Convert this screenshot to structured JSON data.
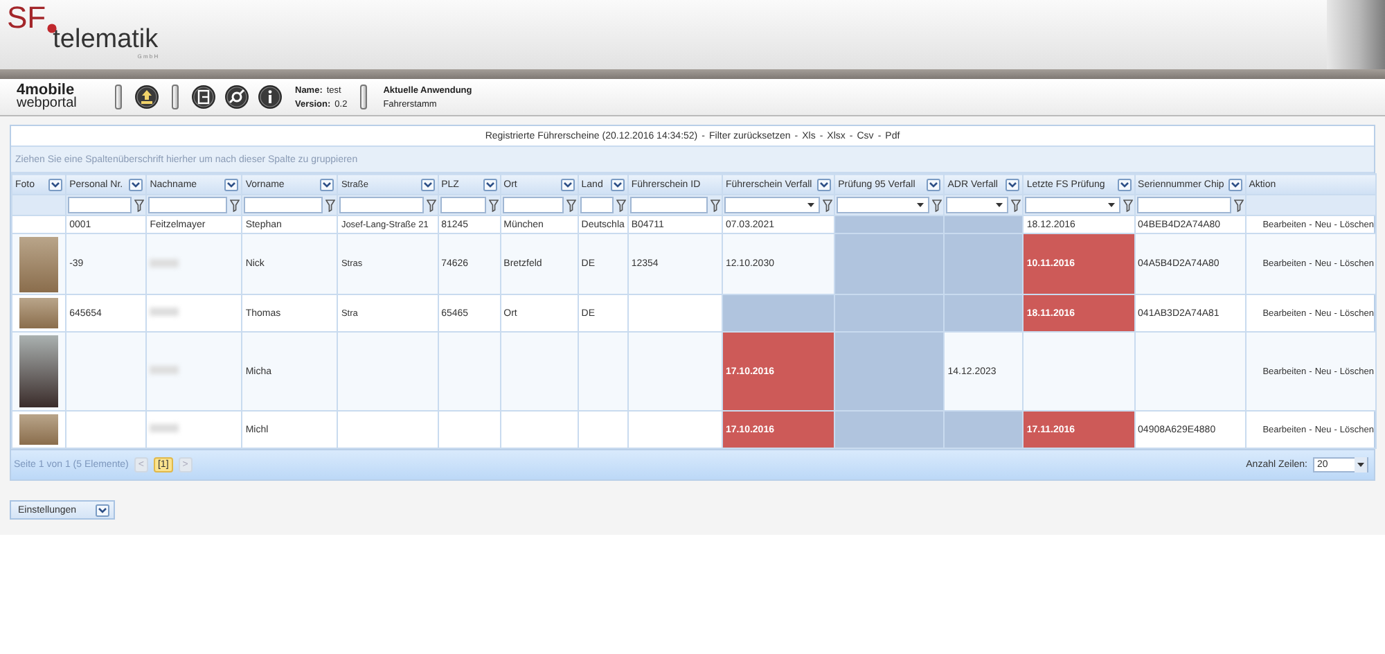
{
  "header": {
    "logo": {
      "prefix": "SF",
      "brand": "telematik",
      "suffix": "G m b H"
    },
    "portal": {
      "line1": "4mobile",
      "line2": "webportal"
    },
    "user_info": {
      "name_label": "Name:",
      "name": "test",
      "version_label": "Version:",
      "version": "0.2"
    },
    "application": {
      "label": "Aktuelle Anwendung",
      "value": "Fahrerstamm"
    }
  },
  "grid": {
    "title": "Registrierte Führerscheine (20.12.2016 14:34:52)",
    "separator": "-",
    "title_links": [
      "Filter zurücksetzen",
      "Xls",
      "Xlsx",
      "Csv",
      "Pdf"
    ],
    "group_hint": "Ziehen Sie eine Spaltenüberschrift hierher um nach dieser Spalte zu gruppieren",
    "columns": [
      {
        "label": "Foto",
        "menu": true,
        "filterable": false
      },
      {
        "label": "Personal Nr.",
        "menu": true,
        "filterable": true,
        "filter_dropdown": false
      },
      {
        "label": "Nachname",
        "menu": true,
        "filterable": true,
        "filter_dropdown": false
      },
      {
        "label": "Vorname",
        "menu": true,
        "filterable": true,
        "filter_dropdown": false
      },
      {
        "label": "Straße",
        "menu": true,
        "filterable": true,
        "filter_dropdown": false
      },
      {
        "label": "PLZ",
        "menu": true,
        "filterable": true,
        "filter_dropdown": false
      },
      {
        "label": "Ort",
        "menu": true,
        "filterable": true,
        "filter_dropdown": false
      },
      {
        "label": "Land",
        "menu": true,
        "filterable": true,
        "filter_dropdown": false
      },
      {
        "label": "Führerschein ID",
        "menu": false,
        "filterable": true,
        "filter_dropdown": false
      },
      {
        "label": "Führerschein Verfall",
        "menu": true,
        "filterable": true,
        "filter_dropdown": true
      },
      {
        "label": "Prüfung 95 Verfall",
        "menu": true,
        "filterable": true,
        "filter_dropdown": true
      },
      {
        "label": "ADR Verfall",
        "menu": true,
        "filterable": true,
        "filter_dropdown": true
      },
      {
        "label": "Letzte FS Prüfung",
        "menu": true,
        "filterable": true,
        "filter_dropdown": true
      },
      {
        "label": "Seriennummer Chip",
        "menu": true,
        "filterable": true,
        "filter_dropdown": false
      },
      {
        "label": "Aktion",
        "menu": false,
        "filterable": false
      }
    ],
    "rows": [
      {
        "cells": [
          {
            "kind": "text"
          },
          {
            "kind": "text",
            "text": "0001"
          },
          {
            "kind": "text",
            "text": "Feitzelmayer"
          },
          {
            "kind": "text",
            "text": "Stephan"
          },
          {
            "kind": "text",
            "text": "Josef-Lang-Straße 21"
          },
          {
            "kind": "text",
            "text": "81245"
          },
          {
            "kind": "text",
            "text": "München"
          },
          {
            "kind": "text",
            "text": "Deutschla"
          },
          {
            "kind": "text",
            "text": "B04711"
          },
          {
            "kind": "text",
            "text": "07.03.2021"
          },
          {
            "kind": "missing"
          },
          {
            "kind": "missing"
          },
          {
            "kind": "text",
            "text": "18.12.2016"
          },
          {
            "kind": "text",
            "text": "04BEB4D2A74A80"
          },
          {
            "kind": "actions",
            "actions": [
              "Bearbeiten",
              "Neu",
              "Löschen"
            ]
          }
        ]
      },
      {
        "cells": [
          {
            "kind": "photo"
          },
          {
            "kind": "text",
            "text": "-39"
          },
          {
            "kind": "blurred"
          },
          {
            "kind": "text",
            "text": "Nick"
          },
          {
            "kind": "text",
            "text": "Stras"
          },
          {
            "kind": "text",
            "text": "74626"
          },
          {
            "kind": "text",
            "text": "Bretzfeld"
          },
          {
            "kind": "text",
            "text": "DE"
          },
          {
            "kind": "text",
            "text": "12354"
          },
          {
            "kind": "text",
            "text": "12.10.2030"
          },
          {
            "kind": "missing"
          },
          {
            "kind": "missing"
          },
          {
            "kind": "expired",
            "text": "10.11.2016"
          },
          {
            "kind": "text",
            "text": "04A5B4D2A74A80"
          },
          {
            "kind": "actions",
            "actions": [
              "Bearbeiten",
              "Neu",
              "Löschen"
            ]
          }
        ]
      },
      {
        "cells": [
          {
            "kind": "thumb"
          },
          {
            "kind": "text",
            "text": "645654"
          },
          {
            "kind": "blurred"
          },
          {
            "kind": "text",
            "text": "Thomas"
          },
          {
            "kind": "text",
            "text": "Stra"
          },
          {
            "kind": "text",
            "text": "65465"
          },
          {
            "kind": "text",
            "text": "Ort"
          },
          {
            "kind": "text",
            "text": "DE"
          },
          {
            "kind": "text"
          },
          {
            "kind": "missing"
          },
          {
            "kind": "missing"
          },
          {
            "kind": "missing"
          },
          {
            "kind": "expired",
            "text": "18.11.2016"
          },
          {
            "kind": "text",
            "text": "041AB3D2A74A81"
          },
          {
            "kind": "actions",
            "actions": [
              "Bearbeiten",
              "Neu",
              "Löschen"
            ]
          }
        ]
      },
      {
        "cells": [
          {
            "kind": "portrait"
          },
          {
            "kind": "text"
          },
          {
            "kind": "blurred"
          },
          {
            "kind": "text",
            "text": "Micha"
          },
          {
            "kind": "text"
          },
          {
            "kind": "text"
          },
          {
            "kind": "text"
          },
          {
            "kind": "text"
          },
          {
            "kind": "text"
          },
          {
            "kind": "expired",
            "text": "17.10.2016"
          },
          {
            "kind": "missing"
          },
          {
            "kind": "text",
            "text": "14.12.2023"
          },
          {
            "kind": "text"
          },
          {
            "kind": "text"
          },
          {
            "kind": "actions",
            "actions": [
              "Bearbeiten",
              "Neu",
              "Löschen"
            ]
          }
        ]
      },
      {
        "cells": [
          {
            "kind": "thumb"
          },
          {
            "kind": "text"
          },
          {
            "kind": "blurred"
          },
          {
            "kind": "text",
            "text": "Michl"
          },
          {
            "kind": "text"
          },
          {
            "kind": "text"
          },
          {
            "kind": "text"
          },
          {
            "kind": "text"
          },
          {
            "kind": "text"
          },
          {
            "kind": "expired",
            "text": "17.10.2016"
          },
          {
            "kind": "missing"
          },
          {
            "kind": "missing"
          },
          {
            "kind": "expired",
            "text": "17.11.2016"
          },
          {
            "kind": "text",
            "text": "04908A629E4880"
          },
          {
            "kind": "actions",
            "actions": [
              "Bearbeiten",
              "Neu",
              "Löschen"
            ]
          }
        ]
      }
    ],
    "pager": {
      "info": "Seite 1 von 1 (5 Elemente)",
      "prev": {
        "label": "<",
        "disabled": true
      },
      "pages": [
        {
          "label": "[1]",
          "selected": true
        }
      ],
      "next": {
        "label": ">",
        "disabled": true
      },
      "rows_label": "Anzahl Zeilen:",
      "rows_value": "20"
    }
  },
  "settings_button": "Einstellungen"
}
